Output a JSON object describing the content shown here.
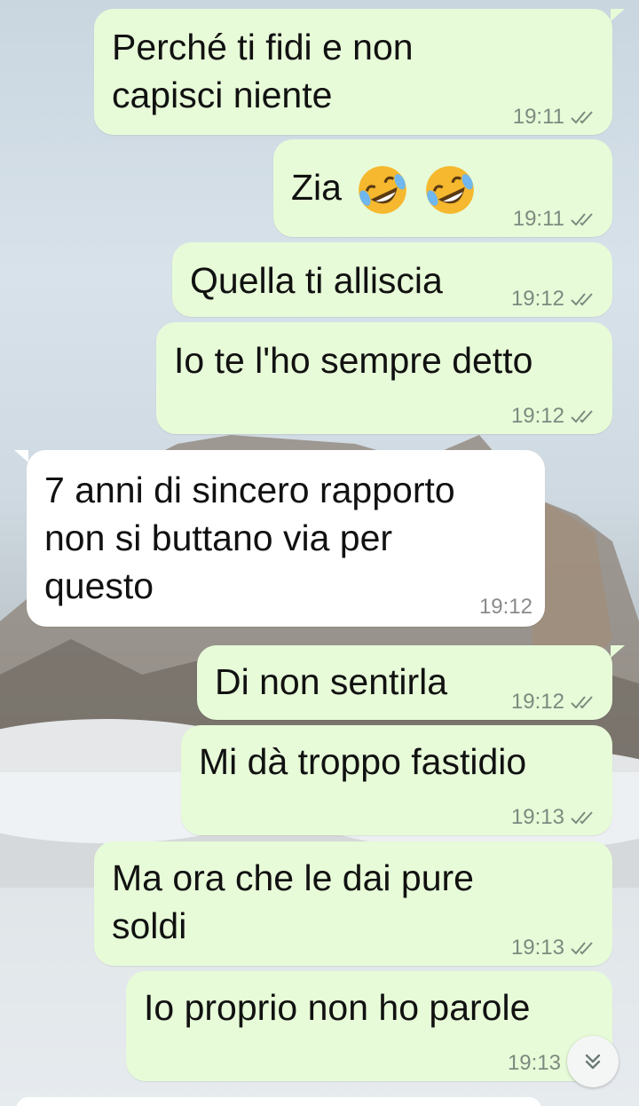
{
  "chat": {
    "messages": [
      {
        "direction": "out",
        "text": "Perché ti fidi e non\ncapisci niente",
        "time": "19:11",
        "status_icon": "double-check-icon"
      },
      {
        "direction": "out",
        "text": "Zia",
        "emoji": [
          "rolling-on-floor-laughing-emoji",
          "rolling-on-floor-laughing-emoji"
        ],
        "time": "19:11",
        "status_icon": "double-check-icon"
      },
      {
        "direction": "out",
        "text": "Quella ti alliscia",
        "time": "19:12",
        "status_icon": "double-check-icon"
      },
      {
        "direction": "out",
        "text": "Io te l'ho sempre detto",
        "time": "19:12",
        "status_icon": "double-check-icon"
      },
      {
        "direction": "in",
        "text": "7 anni di sincero rapporto\nnon si buttano via per\nquesto",
        "time": "19:12"
      },
      {
        "direction": "out",
        "text": "Di non sentirla",
        "time": "19:12",
        "status_icon": "double-check-icon"
      },
      {
        "direction": "out",
        "text": "Mi dà troppo fastidio",
        "time": "19:13",
        "status_icon": "double-check-icon"
      },
      {
        "direction": "out",
        "text": "Ma ora che le dai pure\nsoldi",
        "time": "19:13",
        "status_icon": "double-check-icon"
      },
      {
        "direction": "out",
        "text": "Io proprio non ho parole",
        "time": "19:13",
        "status_icon": "double-check-icon"
      }
    ],
    "scroll_button_icon": "double-chevron-down-icon"
  },
  "colors": {
    "outgoing_bubble": "#e7fbd8",
    "incoming_bubble": "#ffffff",
    "timestamp": "#7d8a7f"
  }
}
